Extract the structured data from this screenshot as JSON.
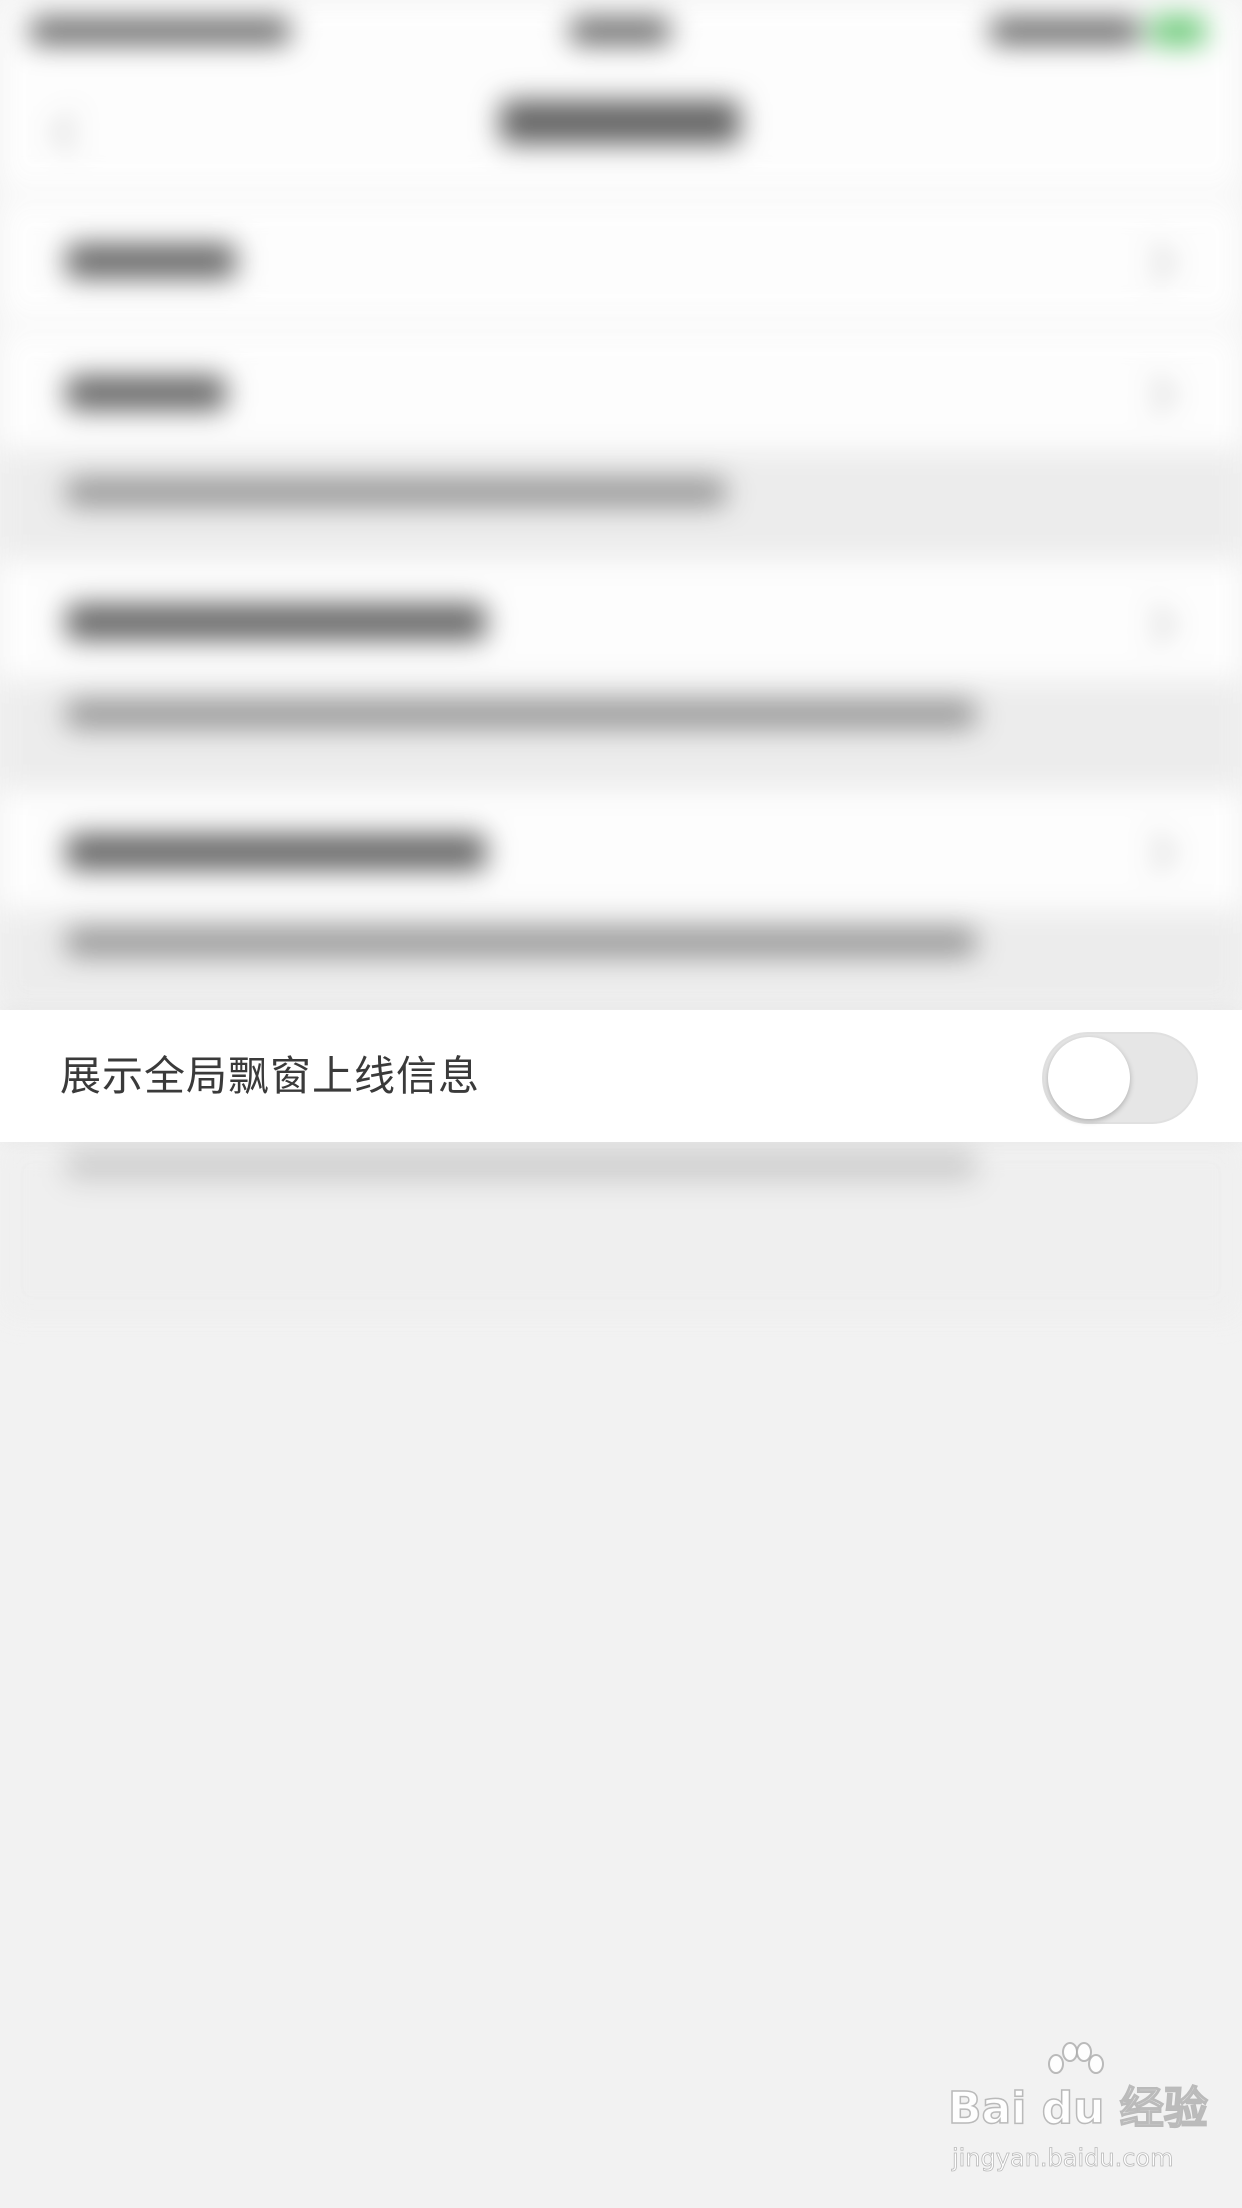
{
  "setting_row": {
    "label": "展示全局飘窗上线信息",
    "toggle_on": false
  },
  "colors": {
    "page_background": "#f2f2f2",
    "row_background": "#ffffff",
    "label_text": "#3a3a3a",
    "toggle_off_track": "#e6e6e6",
    "toggle_knob": "#ffffff"
  },
  "watermark": {
    "brand": "Bai du 经验",
    "url": "jingyan.baidu.com"
  }
}
